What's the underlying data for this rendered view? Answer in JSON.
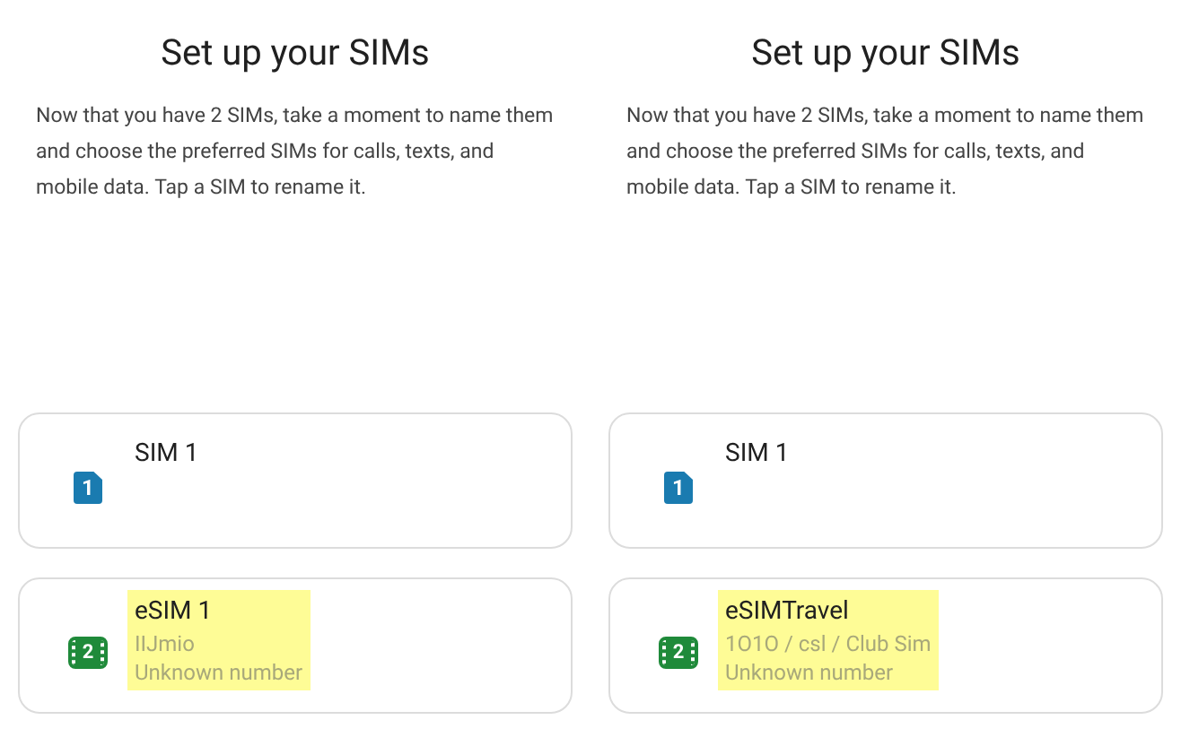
{
  "panels": [
    {
      "title": "Set up your SIMs",
      "description": "Now that you have 2 SIMs, take a moment to name them and choose the preferred SIMs for calls, texts, and mobile data. Tap a SIM to rename it.",
      "sims": [
        {
          "kind": "physical",
          "badge": "1",
          "name": "SIM 1",
          "highlighted": false
        },
        {
          "kind": "esim",
          "badge": "2",
          "name": "eSIM 1",
          "carrier": "IIJmio",
          "number": "Unknown number",
          "highlighted": true
        }
      ]
    },
    {
      "title": "Set up your SIMs",
      "description": "Now that you have 2 SIMs, take a moment to name them and choose the preferred SIMs for calls, texts, and mobile data. Tap a SIM to rename it.",
      "sims": [
        {
          "kind": "physical",
          "badge": "1",
          "name": "SIM 1",
          "highlighted": false
        },
        {
          "kind": "esim",
          "badge": "2",
          "name": "eSIMTravel",
          "carrier": "1O1O / csl / Club Sim",
          "number": "Unknown number",
          "highlighted": true
        }
      ]
    }
  ]
}
